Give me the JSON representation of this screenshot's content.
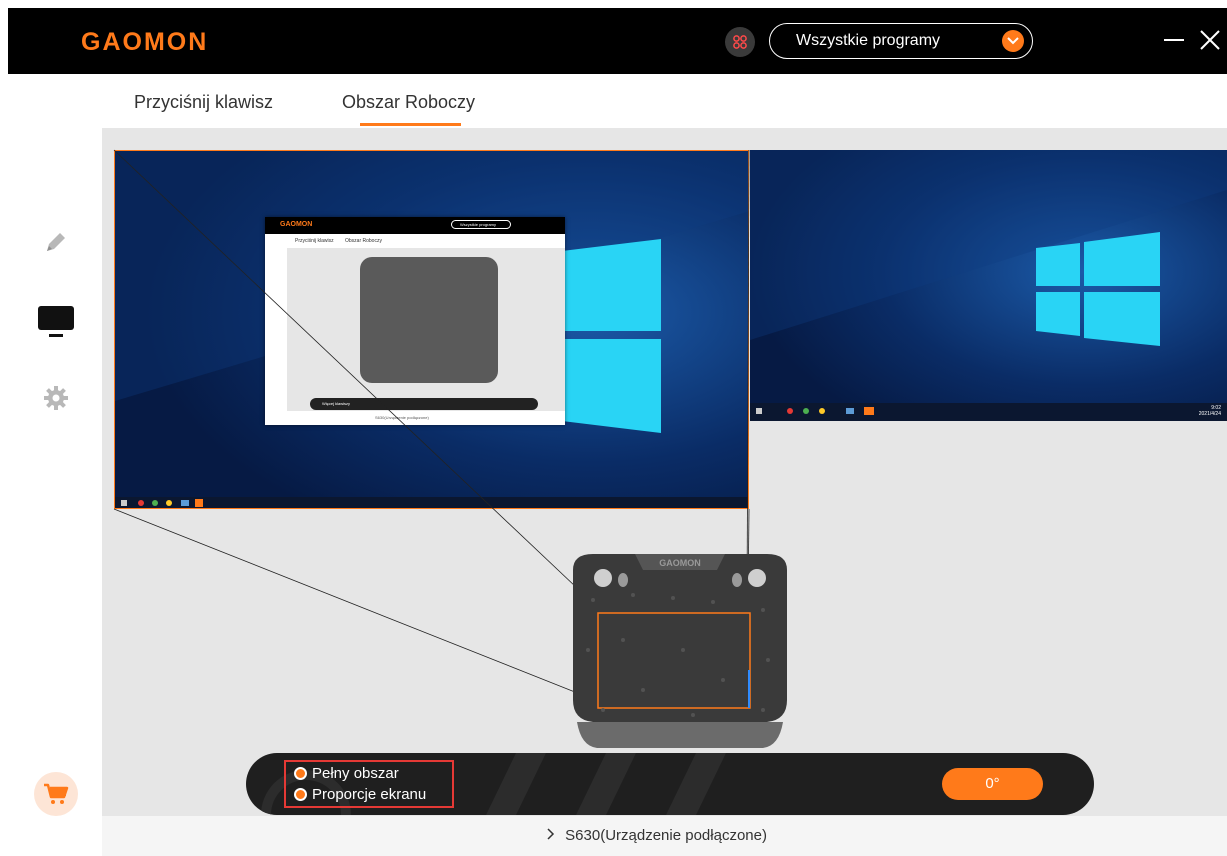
{
  "header": {
    "logo": "GAOMON",
    "app_selector": "Wszystkie programy"
  },
  "tabs": [
    {
      "label": "Przyciśnij klawisz",
      "active": false
    },
    {
      "label": "Obszar Roboczy",
      "active": true
    }
  ],
  "sidebar": {
    "items": [
      {
        "name": "pen-icon",
        "active": false
      },
      {
        "name": "monitor-icon",
        "active": true
      },
      {
        "name": "gear-icon",
        "active": false
      }
    ],
    "cart": "cart-icon"
  },
  "workarea": {
    "options": {
      "full_area": "Pełny obszar",
      "screen_ratio": "Proporcje ekranu"
    },
    "rotation": "0°",
    "thumbnail": {
      "logo": "GAOMON",
      "app_selector": "Wszystkie programy",
      "tab1": "Przyciśnij klawisz",
      "tab2": "Obszar Roboczy",
      "option": "Więcej klawiszy",
      "status": "S630(Urządzenie podłączone)"
    },
    "taskbar_clock": {
      "time": "9:02",
      "date": "2021/4/24"
    }
  },
  "footer": {
    "device_status": "S630(Urządzenie podłączone)"
  },
  "colors": {
    "accent": "#ff7a1a",
    "titlebar": "#000000",
    "workarea_bg": "#e6e6e6",
    "highlight": "#e53935"
  }
}
